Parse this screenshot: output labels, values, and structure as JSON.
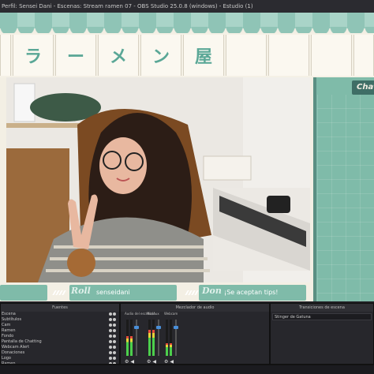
{
  "window": {
    "title": "Perfil: Sensei Dani - Escenas: Stream ramen 07 - OBS Studio 25.0.8 (windows) - Estudio (1)"
  },
  "banner": {
    "glyphs": [
      "ラ",
      "ー",
      "メ",
      "ン",
      "屋"
    ]
  },
  "chat": {
    "label": "Chat"
  },
  "bars": [
    {
      "label": "",
      "text": ""
    },
    {
      "label": "Roll",
      "text": "senseidani"
    },
    {
      "label": "Don",
      "text": "¡Se aceptan tips!"
    }
  ],
  "docks": {
    "sources": {
      "title": "Fuentes",
      "items": [
        "Escena",
        "Subtítulos",
        "Cam",
        "Ramen",
        "Fondo",
        "Pantalla de Chatting",
        "Webcam Alert",
        "Donaciones",
        "Logo",
        "Ramen"
      ]
    },
    "mixer": {
      "title": "Mezclador de audio",
      "channels": [
        {
          "name": "Audio del escritorio",
          "level": 0.55
        },
        {
          "name": "Mic/Aux",
          "level": 0.72
        },
        {
          "name": "Webcam",
          "level": 0.35
        }
      ]
    },
    "transitions": {
      "title": "Transiciones de escena",
      "current": "Stinger de Gatuna"
    }
  },
  "colors": {
    "teal": "#7fbba9",
    "accent": "#5aa796",
    "dark_teal": "#3f6e66"
  },
  "icons": [
    "eye-icon",
    "lock-icon",
    "speaker-icon",
    "gear-icon"
  ]
}
